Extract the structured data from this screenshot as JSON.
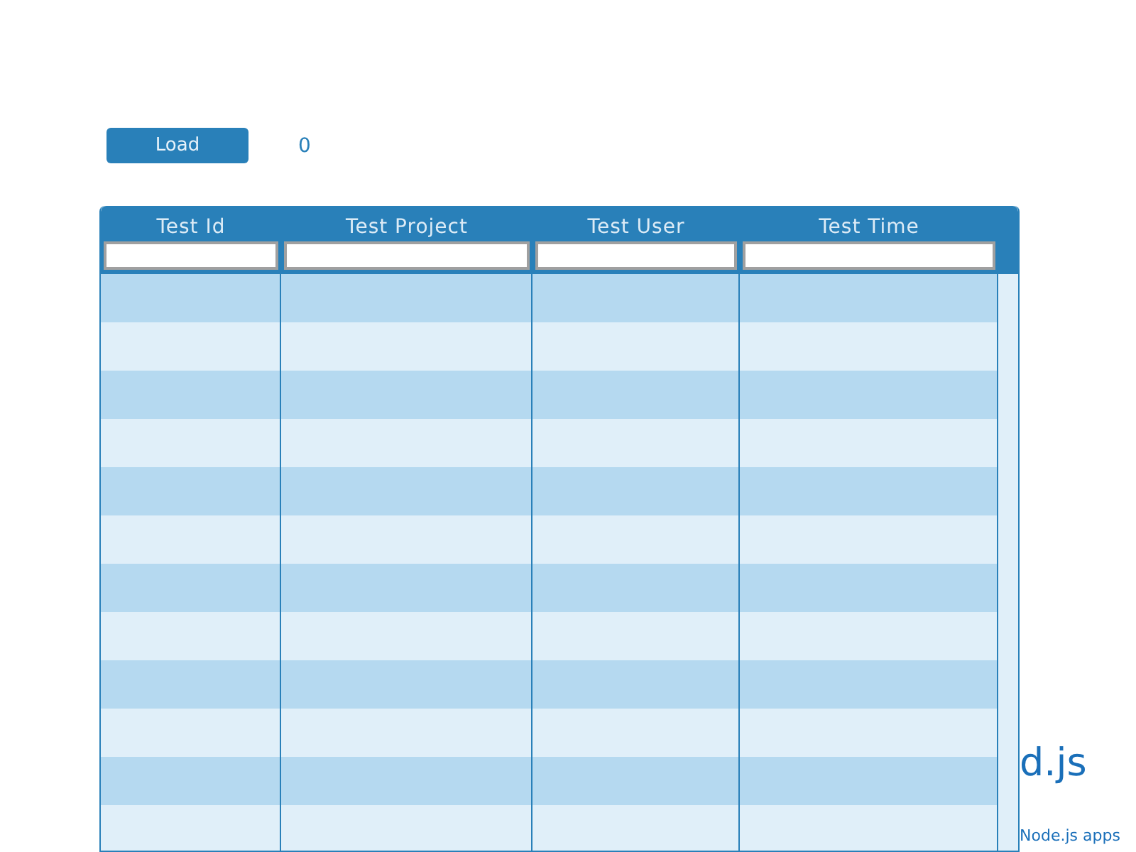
{
  "toolbar": {
    "load_button": "Load",
    "count": "0"
  },
  "table": {
    "columns": [
      {
        "label": "Test Id"
      },
      {
        "label": "Test Project"
      },
      {
        "label": "Test User"
      },
      {
        "label": "Test Time"
      }
    ]
  },
  "background": {
    "heading": "d.js",
    "caption": "Node.js apps"
  }
}
